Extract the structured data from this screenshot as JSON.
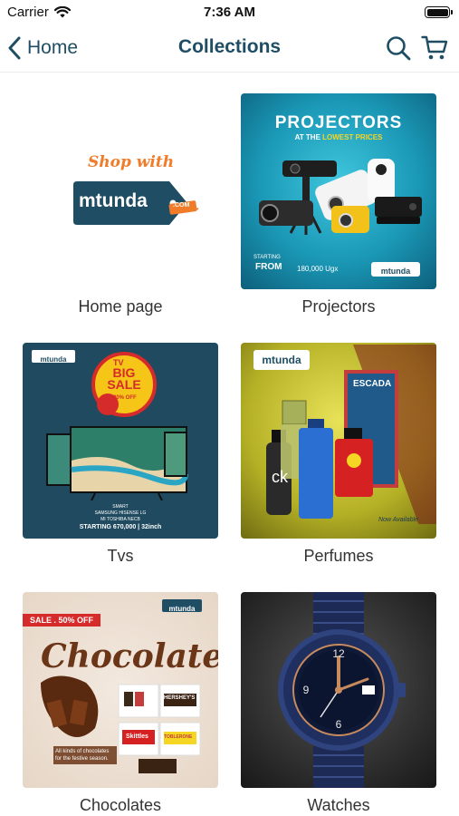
{
  "status": {
    "carrier": "Carrier",
    "time": "7:36 AM"
  },
  "nav": {
    "back_label": "Home",
    "title": "Collections"
  },
  "collections": [
    {
      "label": "Home page",
      "image": {
        "tagline": "Shop with",
        "logo": "mtunda",
        "logo_suffix": ".COM"
      }
    },
    {
      "label": "Projectors",
      "image": {
        "heading": "PROJECTORS",
        "subheading": "AT THE",
        "subheading_highlight": "LOWEST PRICES",
        "starting": "STARTING",
        "from": "FROM",
        "price": "180,000 Ugx",
        "logo": "mtunda"
      }
    },
    {
      "label": "Tvs",
      "image": {
        "logo": "mtunda",
        "badge_top": "TV",
        "badge_main": "BIG SALE",
        "badge_off": "20% OFF",
        "brands_title": "SMART",
        "brands_line1": "SAMSUNG   HISENSE   LG",
        "brands_line2": "MI   TOSHIBA   NECB",
        "starting": "STARTING 670,000 | 32inch"
      }
    },
    {
      "label": "Perfumes",
      "image": {
        "logo": "mtunda",
        "note1": "Now Available",
        "bottle_ck": "ck",
        "bottle_box": "ESCADA"
      }
    },
    {
      "label": "Chocolates",
      "image": {
        "sale": "SALE . 50% OFF",
        "heading": "Chocolate",
        "logo": "mtunda",
        "desc": "All kinds of chocolates for the festive season.",
        "brand1": "HERSHEY'S",
        "brand2": "Skittles",
        "brand3": "TOBLERONE"
      }
    },
    {
      "label": "Watches",
      "image": {}
    }
  ],
  "colors": {
    "brand": "#1f4e64",
    "accent": "#f07c2a"
  }
}
